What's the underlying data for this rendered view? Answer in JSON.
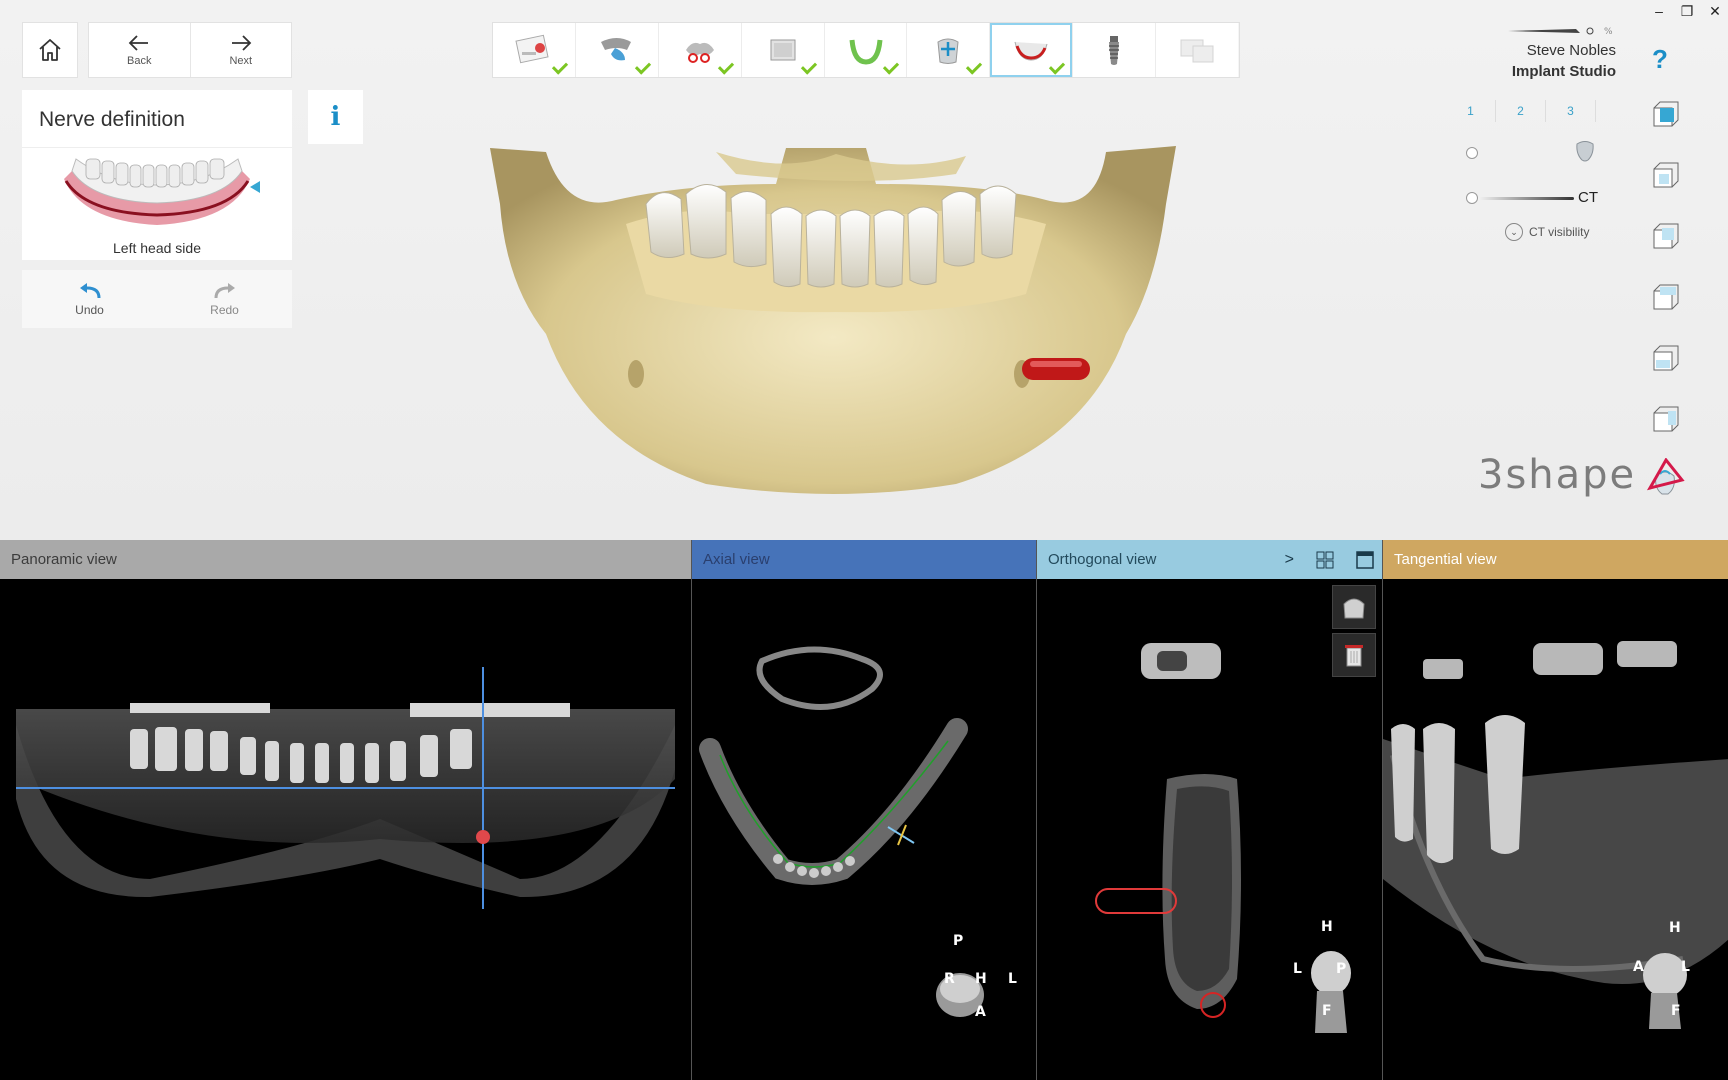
{
  "window_controls": {
    "minimize": "–",
    "restore": "❐",
    "close": "✕"
  },
  "nav": {
    "back_label": "Back",
    "next_label": "Next"
  },
  "workflow_steps": [
    {
      "name": "order-form",
      "done": true
    },
    {
      "name": "scan",
      "done": true
    },
    {
      "name": "cut",
      "done": true
    },
    {
      "name": "volume",
      "done": true
    },
    {
      "name": "arch",
      "done": true
    },
    {
      "name": "tooth-add",
      "done": true
    },
    {
      "name": "nerve",
      "done": true,
      "active": true
    },
    {
      "name": "implant",
      "done": false
    },
    {
      "name": "report",
      "done": false,
      "dim": true
    }
  ],
  "step_panel": {
    "title": "Nerve definition",
    "caption": "Left head side",
    "info_label": "i"
  },
  "undo": {
    "undo_label": "Undo",
    "redo_label": "Redo"
  },
  "user": {
    "name": "Steve Nobles",
    "studio": "Implant Studio",
    "pen_percent": "%"
  },
  "help_label": "?",
  "layout_tabs": [
    "1",
    "2",
    "3"
  ],
  "ct_slider": {
    "label": "CT",
    "visibility_label": "CT visibility"
  },
  "brand": {
    "name": "3shape"
  },
  "panes": {
    "panoramic": {
      "title": "Panoramic view"
    },
    "axial": {
      "title": "Axial view",
      "orient": {
        "top": "P",
        "left": "R",
        "center": "H",
        "right": "L",
        "bottom": "A"
      }
    },
    "orthogonal": {
      "title": "Orthogonal view",
      "chevron": ">",
      "orient": {
        "top": "H",
        "left": "L",
        "center": "P",
        "bottom": "F"
      }
    },
    "tangential": {
      "title": "Tangential view",
      "orient": {
        "top": "H",
        "left": "A",
        "right": "L",
        "bottom": "F"
      }
    }
  },
  "colors": {
    "accent": "#1b8ec7",
    "check": "#7cc623",
    "axial_header": "#4673b9",
    "ortho_header": "#98cbe0",
    "tang_header": "#cfa761",
    "nerve": "#c81e1e"
  }
}
